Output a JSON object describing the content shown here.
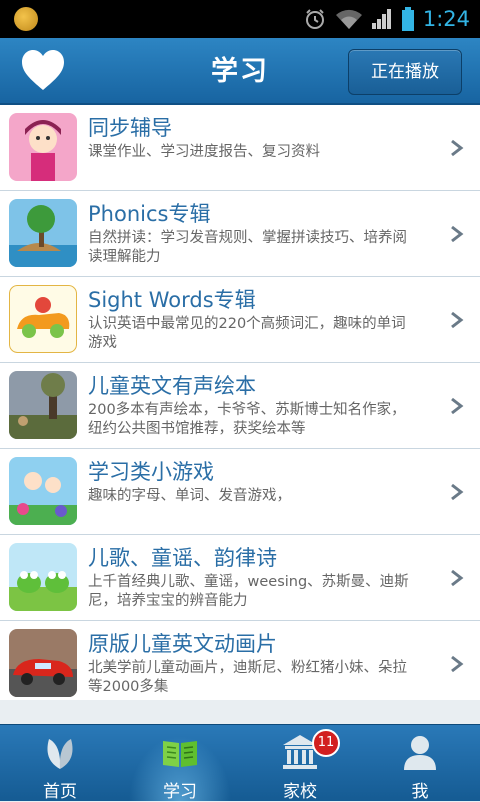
{
  "status_bar": {
    "time": "1:24"
  },
  "header": {
    "title": "学习",
    "playing_button": "正在播放"
  },
  "items": [
    {
      "title": "同步辅导",
      "desc": "课堂作业、学习进度报告、复习资料",
      "thumb": "girl-character-thumbnail"
    },
    {
      "title": "Phonics专辑",
      "desc": "自然拼读：学习发音规则、掌握拼读技巧、培养阅读理解能力",
      "thumb": "island-tree-thumbnail"
    },
    {
      "title": "Sight Words专辑",
      "desc": "认识英语中最常见的220个高频词汇，趣味的单词游戏",
      "thumb": "cartoon-car-thumbnail"
    },
    {
      "title": "儿童英文有声绘本",
      "desc": "200多本有声绘本，卡爷爷、苏斯博士知名作家，纽约公共图书馆推荐，获奖绘本等",
      "thumb": "storybook-landscape-thumbnail"
    },
    {
      "title": "学习类小游戏",
      "desc": "趣味的字母、单词、发音游戏，",
      "thumb": "kids-flowers-thumbnail"
    },
    {
      "title": "儿歌、童谣、韵律诗",
      "desc": "上千首经典儿歌、童谣，weesing、苏斯曼、迪斯尼，培养宝宝的辨音能力",
      "thumb": "frogs-thumbnail"
    },
    {
      "title": "原版儿童英文动画片",
      "desc": "北美学前儿童动画片，迪斯尼、粉红猪小妹、朵拉等2000多集",
      "thumb": "race-cars-thumbnail"
    }
  ],
  "nav": [
    {
      "label": "首页",
      "icon": "leaf-icon"
    },
    {
      "label": "学习",
      "icon": "book-icon",
      "active": true
    },
    {
      "label": "家校",
      "icon": "school-building-icon",
      "badge": "11"
    },
    {
      "label": "我",
      "icon": "user-icon"
    }
  ],
  "colors": {
    "accent": "#1e6fae",
    "title_text": "#2a6ea6",
    "badge": "#d21f1f",
    "time": "#33b5e5"
  }
}
